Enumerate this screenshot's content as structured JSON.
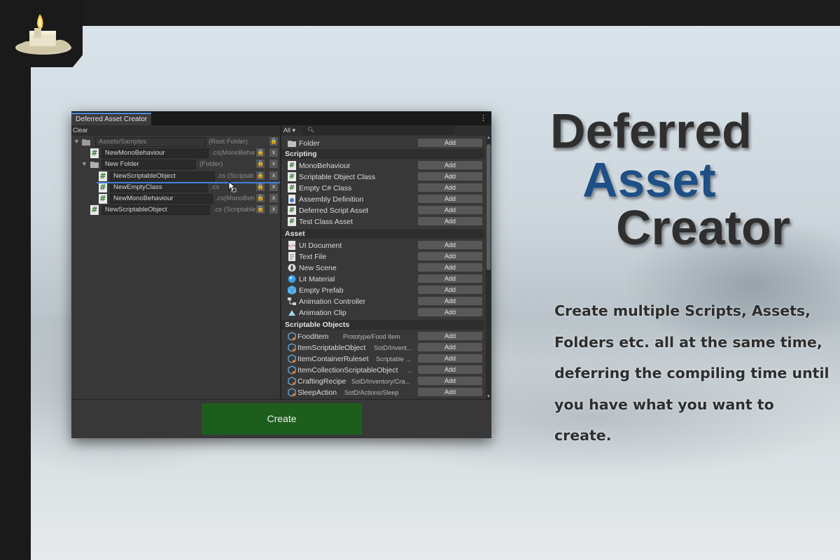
{
  "window": {
    "tab_title": "Deferred Asset Creator",
    "menu_glyph": "⋮",
    "clear_label": "Clear",
    "create_label": "Create"
  },
  "tree": {
    "rows": [
      {
        "name": "Assets/Samples",
        "ext": "(Root Folder)",
        "kind": "folder",
        "foldout": "▼"
      },
      {
        "name": "NewMonoBehaviour",
        "ext": ".cs(MonoBehav",
        "kind": "script"
      },
      {
        "name": "New Folder",
        "ext": "(Folder)",
        "kind": "folder",
        "foldout": "▼"
      },
      {
        "name": "NewScriptableObject",
        "ext": ".cs (Scriptab",
        "kind": "script"
      },
      {
        "name": "NewEmptyClass",
        "ext": ".cs",
        "kind": "script"
      },
      {
        "name": "NewMonoBehaviour",
        "ext": ".cs(MonoBeh",
        "kind": "script"
      },
      {
        "name": "NewScriptableObject",
        "ext": ".cs (Scriptable",
        "kind": "script"
      }
    ],
    "lock_glyph": "🔒",
    "remove_glyph": "x"
  },
  "filter": {
    "dropdown_value": "All ▾",
    "search_placeholder": ""
  },
  "catalog": {
    "add_label": "Add",
    "folder_item": {
      "label": "Folder",
      "icon": "folder-icon"
    },
    "sections": [
      {
        "title": "Scripting",
        "items": [
          {
            "label": "MonoBehaviour",
            "icon": "csharp-script-icon"
          },
          {
            "label": "Scriptable Object Class",
            "icon": "csharp-script-icon"
          },
          {
            "label": "Empty C# Class",
            "icon": "csharp-script-icon"
          },
          {
            "label": "Assembly Definition",
            "icon": "assembly-definition-icon"
          },
          {
            "label": "Deferred Script Asset",
            "icon": "csharp-script-icon"
          },
          {
            "label": "Test Class Asset",
            "icon": "csharp-script-icon"
          }
        ]
      },
      {
        "title": "Asset",
        "items": [
          {
            "label": "UI Document",
            "icon": "ui-document-icon"
          },
          {
            "label": "Text File",
            "icon": "text-file-icon"
          },
          {
            "label": "New Scene",
            "icon": "scene-icon"
          },
          {
            "label": "Lit Material",
            "icon": "material-icon"
          },
          {
            "label": "Empty Prefab",
            "icon": "prefab-icon"
          },
          {
            "label": "Animation Controller",
            "icon": "animator-controller-icon"
          },
          {
            "label": "Animation Clip",
            "icon": "animation-clip-icon"
          }
        ]
      },
      {
        "title": "Scriptable Objects",
        "items": [
          {
            "label": "FoodItem",
            "path": "Prototype/Food Item",
            "icon": "scriptable-object-icon"
          },
          {
            "label": "ItemScriptableObject",
            "path": "SotD/Invent...",
            "icon": "scriptable-object-icon"
          },
          {
            "label": "ItemContainerRuleset",
            "path": "Scriptable ...",
            "icon": "scriptable-object-icon"
          },
          {
            "label": "ItemCollectionScriptableObject",
            "path": "...",
            "icon": "scriptable-object-icon"
          },
          {
            "label": "CraftingRecipe",
            "path": "SotD/Inventory/Cra...",
            "icon": "scriptable-object-icon"
          },
          {
            "label": "SleepAction",
            "path": "SotD/Actions/Sleep",
            "icon": "scriptable-object-icon"
          }
        ]
      }
    ]
  },
  "promo": {
    "title_line1": "Deferred",
    "title_line2": "Asset",
    "title_line3": "Creator",
    "description": "Create multiple Scripts, Assets, Folders etc. all at the same time, deferring the compiling time until you have what you want to create.",
    "colors": {
      "title_dark": "#2f2f2f",
      "title_accent": "#1e4f86",
      "create_button": "#1d5e1d"
    }
  }
}
